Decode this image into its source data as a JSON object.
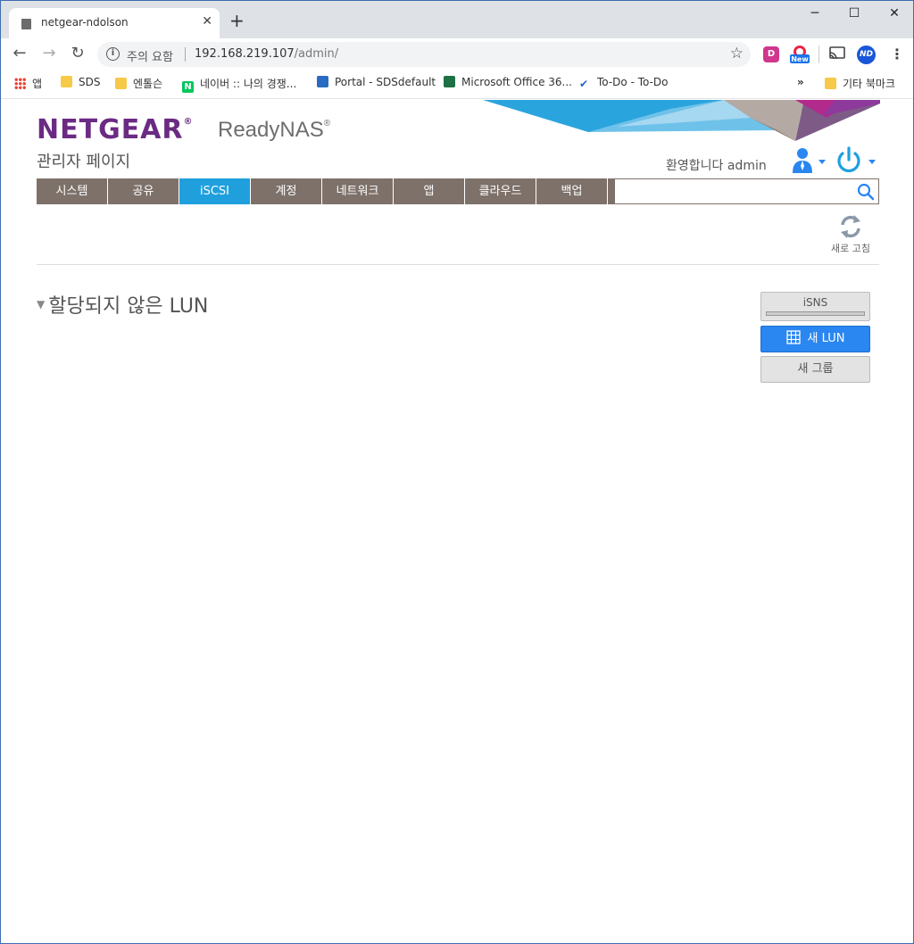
{
  "browser": {
    "tab_title": "netgear-ndolson",
    "address_warning": "주의 요함",
    "url_host": "192.168.219.107",
    "url_path": "/admin/",
    "extension_d_label": "D",
    "extension_new_label": "New",
    "profile_initials": "ND"
  },
  "bookmarks": [
    {
      "label": "앱"
    },
    {
      "label": "SDS"
    },
    {
      "label": "엔톨슨"
    },
    {
      "label": "네이버 :: 나의 경쟁..."
    },
    {
      "label": "Portal - SDSdefault"
    },
    {
      "label": "Microsoft Office 36..."
    },
    {
      "label": "To-Do - To-Do"
    }
  ],
  "bookmarks_overflow": "»",
  "bookmarks_other": "기타 북마크",
  "header": {
    "brand": "NETGEAR",
    "product": "ReadyNAS",
    "subtitle": "관리자 페이지",
    "welcome": "환영합니다 admin"
  },
  "nav": [
    {
      "label": "시스템",
      "active": false
    },
    {
      "label": "공유",
      "active": false
    },
    {
      "label": "iSCSI",
      "active": true
    },
    {
      "label": "계정",
      "active": false
    },
    {
      "label": "네트워크",
      "active": false
    },
    {
      "label": "앱",
      "active": false
    },
    {
      "label": "클라우드",
      "active": false
    },
    {
      "label": "백업",
      "active": false
    }
  ],
  "search": {
    "value": "",
    "placeholder": ""
  },
  "refresh_label": "새로 고침",
  "section": {
    "title": "할당되지 않은 LUN"
  },
  "buttons": {
    "isns": "iSNS",
    "new_lun": "새 LUN",
    "new_group": "새 그룹"
  },
  "colors": {
    "brand_purple": "#6b2a83",
    "nav_bg": "#7e716a",
    "nav_active": "#1fa0dd",
    "primary_button": "#2a86f0"
  }
}
